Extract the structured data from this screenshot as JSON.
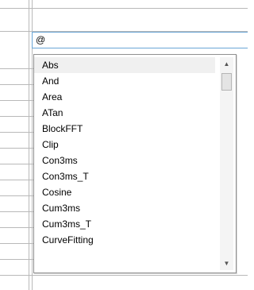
{
  "formula": {
    "value": "@"
  },
  "dropdown": {
    "items": [
      {
        "label": "Abs"
      },
      {
        "label": "And"
      },
      {
        "label": "Area"
      },
      {
        "label": "ATan"
      },
      {
        "label": "BlockFFT"
      },
      {
        "label": "Clip"
      },
      {
        "label": "Con3ms"
      },
      {
        "label": "Con3ms_T"
      },
      {
        "label": "Cosine"
      },
      {
        "label": "Cum3ms"
      },
      {
        "label": "Cum3ms_T"
      },
      {
        "label": "CurveFitting"
      }
    ],
    "selected_index": 0,
    "scrollbar": {
      "up_icon": "▲",
      "down_icon": "▼",
      "position_fraction": 0.0
    }
  }
}
